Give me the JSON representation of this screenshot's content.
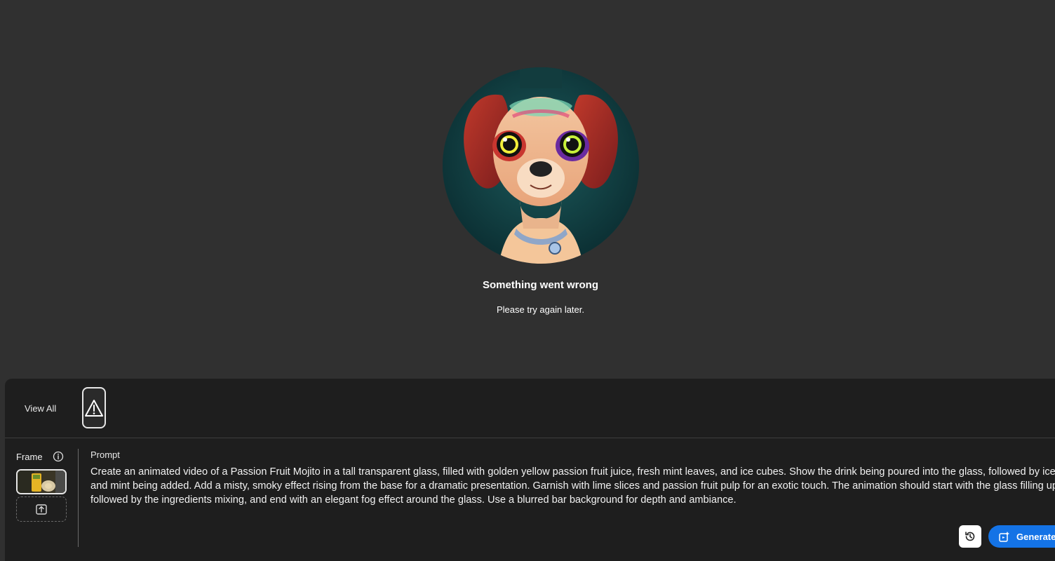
{
  "error": {
    "title": "Something went wrong",
    "message": "Please try again later."
  },
  "gallery": {
    "view_all_label": "View All",
    "items": [
      {
        "icon": "warning-icon",
        "status": "error"
      }
    ]
  },
  "frame": {
    "label": "Frame",
    "info_icon": "info-icon",
    "upload_icon": "upload-icon"
  },
  "prompt": {
    "label": "Prompt",
    "text": "Create an animated video of a Passion Fruit Mojito in a tall transparent glass, filled with golden yellow passion fruit juice, fresh mint leaves, and ice cubes. Show the drink being poured into the glass, followed by ice\nand mint being added. Add a misty, smoky effect rising from the base for a dramatic presentation. Garnish with lime slices and passion fruit pulp for an exotic touch. The animation should start with the glass filling up,\nfollowed by the ingredients mixing, and end with an elegant fog effect around the glass. Use a blurred bar background for depth and ambiance."
  },
  "actions": {
    "history_icon": "history-icon",
    "generate_label": "Generate"
  },
  "colors": {
    "stage_bg": "#303030",
    "panel_bg": "#1e1e1e",
    "accent": "#1473e6"
  }
}
